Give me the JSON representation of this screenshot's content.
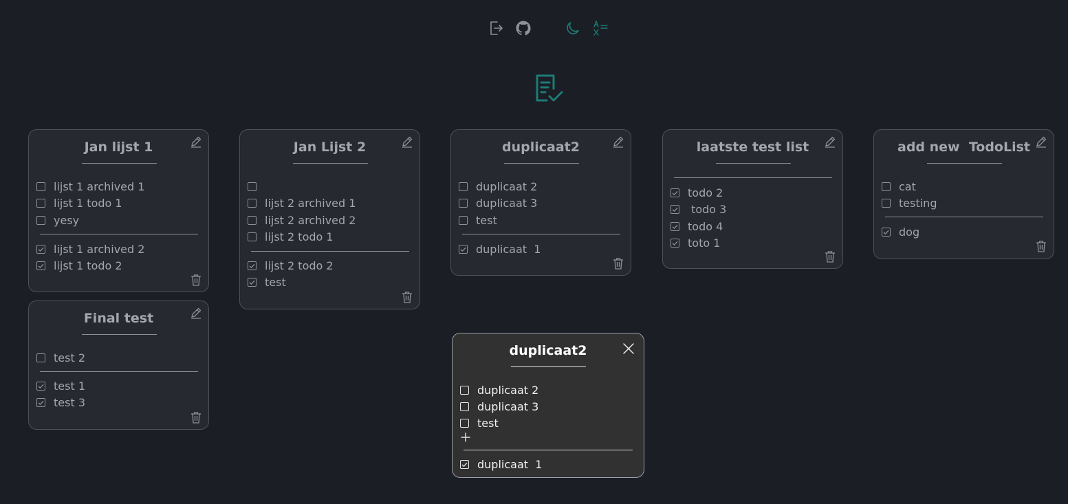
{
  "header": {
    "icons": [
      "logout-icon",
      "github-icon",
      "moon-icon",
      "translate-icon"
    ],
    "logo_icon": "checklist-icon",
    "accent_color": "#1e7b76"
  },
  "lists": [
    {
      "title": "Jan lijst 1",
      "open": [
        "lijst 1 archived 1",
        "lijst 1 todo 1",
        "yesy"
      ],
      "done": [
        "lijst 1 archived 2",
        "lijst 1 todo 2"
      ]
    },
    {
      "title": "Jan Lijst 2",
      "open": [
        "",
        "lijst 2 archived 1",
        "lijst 2 archived 2",
        "lijst 2 todo 1"
      ],
      "done": [
        "lijst 2 todo 2",
        "test"
      ]
    },
    {
      "title": "duplicaat2",
      "open": [
        "duplicaat 2",
        "duplicaat 3",
        "test"
      ],
      "done": [
        "duplicaat  1"
      ]
    },
    {
      "title": "laatste test list",
      "open": [],
      "done": [
        "todo 2",
        " todo 3",
        "todo 4",
        "toto 1"
      ]
    },
    {
      "title": "add new  TodoList",
      "open": [
        "cat",
        "testing"
      ],
      "done": [
        "dog"
      ]
    },
    {
      "title": "Final test",
      "open": [
        "test 2"
      ],
      "done": [
        "test 1",
        "test 3"
      ]
    }
  ],
  "popup": {
    "title": "duplicaat2",
    "open": [
      "duplicaat 2",
      "duplicaat 3",
      "test"
    ],
    "done": [
      "duplicaat  1"
    ]
  }
}
